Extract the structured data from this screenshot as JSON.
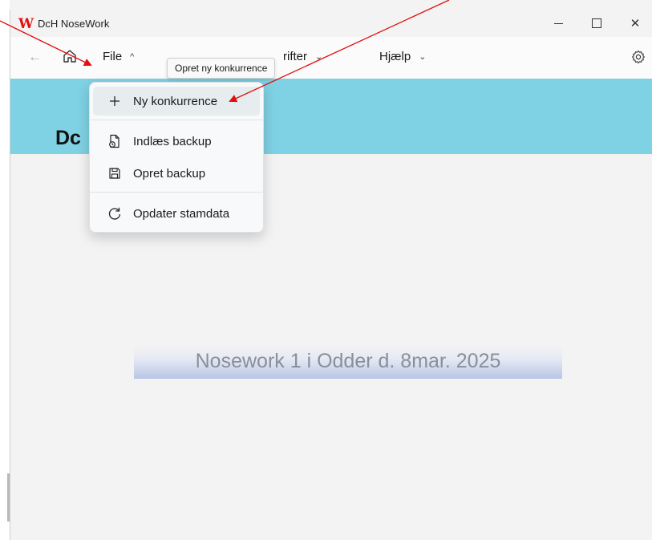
{
  "window": {
    "title": "DcH NoseWork",
    "logo_letter": "W"
  },
  "nav": {
    "file_label": "File",
    "rifter_label": "rifter",
    "hjaelp_label": "Hjælp"
  },
  "tooltip": {
    "text": "Opret ny konkurrence"
  },
  "banner": {
    "title": "Dc"
  },
  "file_menu": {
    "items": [
      {
        "label": "Ny konkurrence",
        "icon": "plus-icon"
      },
      {
        "label": "Indlæs backup",
        "icon": "open-file-icon"
      },
      {
        "label": "Opret backup",
        "icon": "save-icon"
      },
      {
        "label": "Opdater stamdata",
        "icon": "refresh-icon"
      }
    ]
  },
  "competition": {
    "name": "Nosework 1 i Odder d. 8mar. 2025"
  },
  "colors": {
    "banner": "#7fd1e4",
    "annotation_arrow": "#e01010",
    "logo": "#e01010"
  }
}
